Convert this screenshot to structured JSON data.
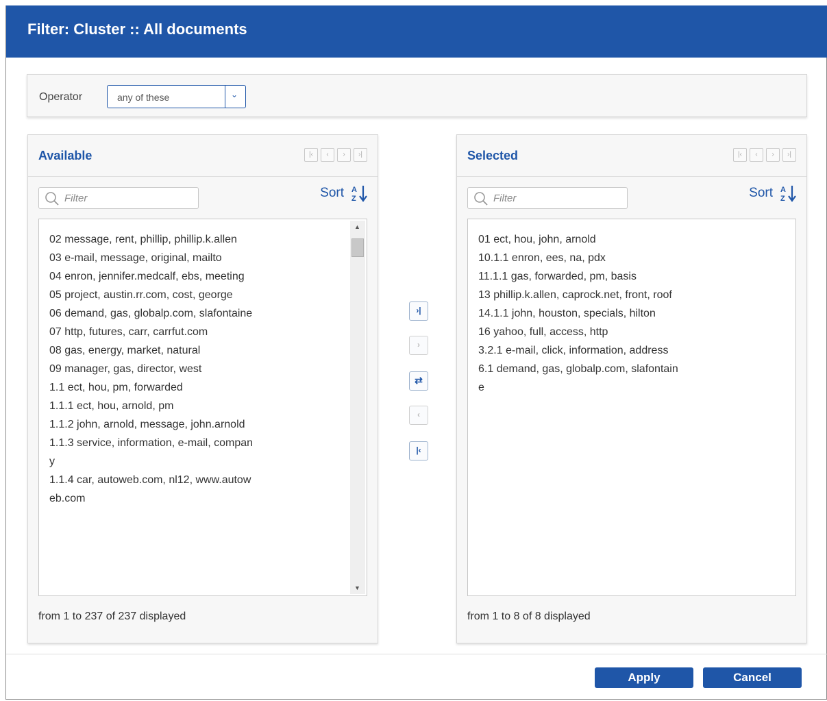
{
  "dialog": {
    "title": "Filter: Cluster :: All documents"
  },
  "operator": {
    "label": "Operator",
    "value": "any of these"
  },
  "available": {
    "title": "Available",
    "filter_placeholder": "Filter",
    "sort_label": "Sort",
    "items": [
      "02 message, rent, phillip, phillip.k.allen",
      "03 e-mail, message, original, mailto",
      "04 enron, jennifer.medcalf, ebs, meeting",
      "05 project, austin.rr.com, cost, george",
      "06 demand, gas, globalp.com, slafontaine",
      "07 http, futures, carr, carrfut.com",
      "08 gas, energy, market, natural",
      "09 manager, gas, director, west",
      "1.1 ect, hou, pm, forwarded",
      "1.1.1 ect, hou, arnold, pm",
      "1.1.2 john, arnold, message, john.arnold",
      "1.1.3 service, information, e-mail, company",
      "1.1.4 car, autoweb.com, nl12, www.autoweb.com"
    ],
    "status": "from 1 to 237 of 237 displayed"
  },
  "selected": {
    "title": "Selected",
    "filter_placeholder": "Filter",
    "sort_label": "Sort",
    "items": [
      "01 ect, hou, john, arnold",
      "10.1.1 enron, ees, na, pdx",
      "11.1.1 gas, forwarded, pm, basis",
      "13 phillip.k.allen, caprock.net, front, roof",
      "14.1.1 john, houston, specials, hilton",
      "16 yahoo, full, access, http",
      "3.2.1 e-mail, click, information, address",
      "6.1 demand, gas, globalp.com, slafontaine"
    ],
    "status": "from 1 to 8 of 8 displayed"
  },
  "footer": {
    "apply_label": "Apply",
    "cancel_label": "Cancel"
  },
  "colors": {
    "brand": "#1f56a8"
  }
}
